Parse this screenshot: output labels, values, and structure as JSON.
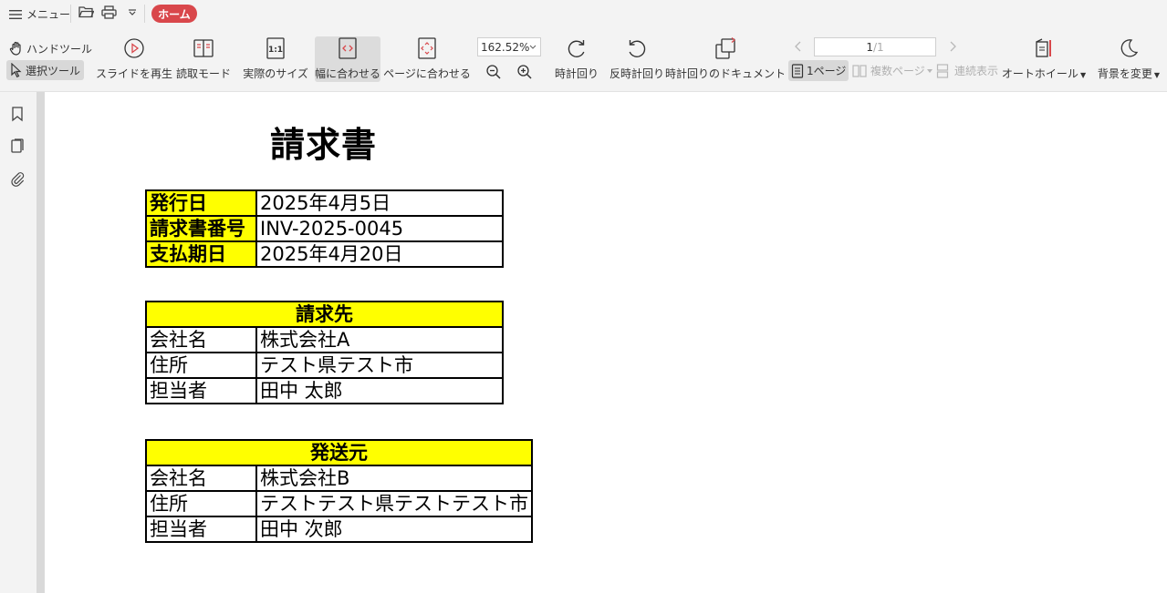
{
  "topbar": {
    "menu_label": "メニュー",
    "home_tab": "ホーム"
  },
  "ribbon": {
    "hand_tool": "ハンドツール",
    "select_tool": "選択ツール",
    "play_slides": "スライドを再生",
    "read_mode": "読取モード",
    "actual_size": "実際のサイズ",
    "fit_width": "幅に合わせる",
    "fit_page": "ページに合わせる",
    "zoom_value": "162.52%",
    "rotate_cw": "時計回り",
    "rotate_ccw": "反時計回り",
    "rotate_doc_cw": "時計回りのドキュメント",
    "page_current": "1",
    "page_total": "/1",
    "single_page": "1ページ",
    "multi_page": "複数ページ",
    "continuous": "連続表示",
    "auto_wheel": "オートホイール",
    "change_bg": "背景を変更"
  },
  "document": {
    "title": "請求書",
    "meta": [
      {
        "label": "発行日",
        "value": "2025年4月5日"
      },
      {
        "label": "請求書番号",
        "value": "INV-2025-0045"
      },
      {
        "label": "支払期日",
        "value": "2025年4月20日"
      }
    ],
    "billing": {
      "header": "請求先",
      "rows": [
        {
          "label": "会社名",
          "value": "株式会社A"
        },
        {
          "label": "住所",
          "value": "テスト県テスト市"
        },
        {
          "label": "担当者",
          "value": "田中 太郎"
        }
      ]
    },
    "sender": {
      "header": "発送元",
      "rows": [
        {
          "label": "会社名",
          "value": "株式会社B"
        },
        {
          "label": "住所",
          "value": "テストテスト県テストテスト市"
        },
        {
          "label": "担当者",
          "value": "田中 次郎"
        }
      ]
    }
  },
  "colors": {
    "accent": "#d9474b",
    "highlight": "#ffff00"
  }
}
